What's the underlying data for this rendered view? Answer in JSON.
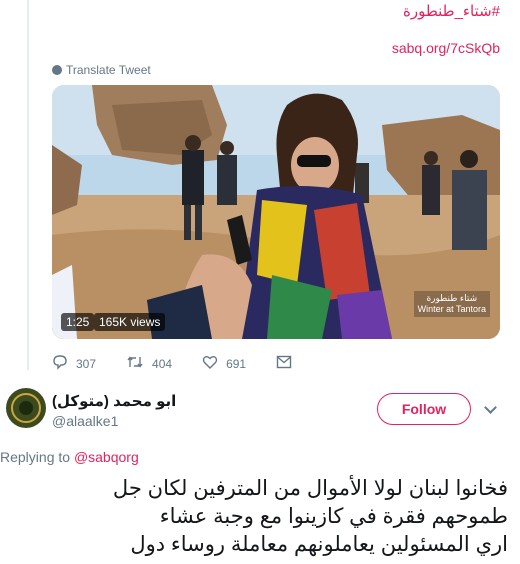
{
  "tweet_top": {
    "hashtag": "#شتاء_طنطورة",
    "link": "sabq.org/7cSkQb",
    "translate_label": "Translate Tweet"
  },
  "video": {
    "duration": "1:25",
    "views": "165K views",
    "watermark_line1": "شتاء طنطورة",
    "watermark_line2": "Winter at Tantora"
  },
  "actions": {
    "replies": "307",
    "retweets": "404",
    "likes": "691"
  },
  "reply_tweet": {
    "name": "ابو محمد (متوكل)",
    "handle": "@alaalke1",
    "follow_label": "Follow",
    "replying_to_label": "Replying to",
    "replying_to_handle": "@sabqorg",
    "text_line1": "فخانوا لبنان لولا الأموال من المترفين لكان جل",
    "text_line2": "طموحهم فقرة في كازينوا مع وجبة عشاء",
    "text_line3": "اري المسئولين يعاملونهم معاملة روساء دول"
  },
  "colors": {
    "accent": "#e0245e",
    "secondary_text": "#657786"
  }
}
